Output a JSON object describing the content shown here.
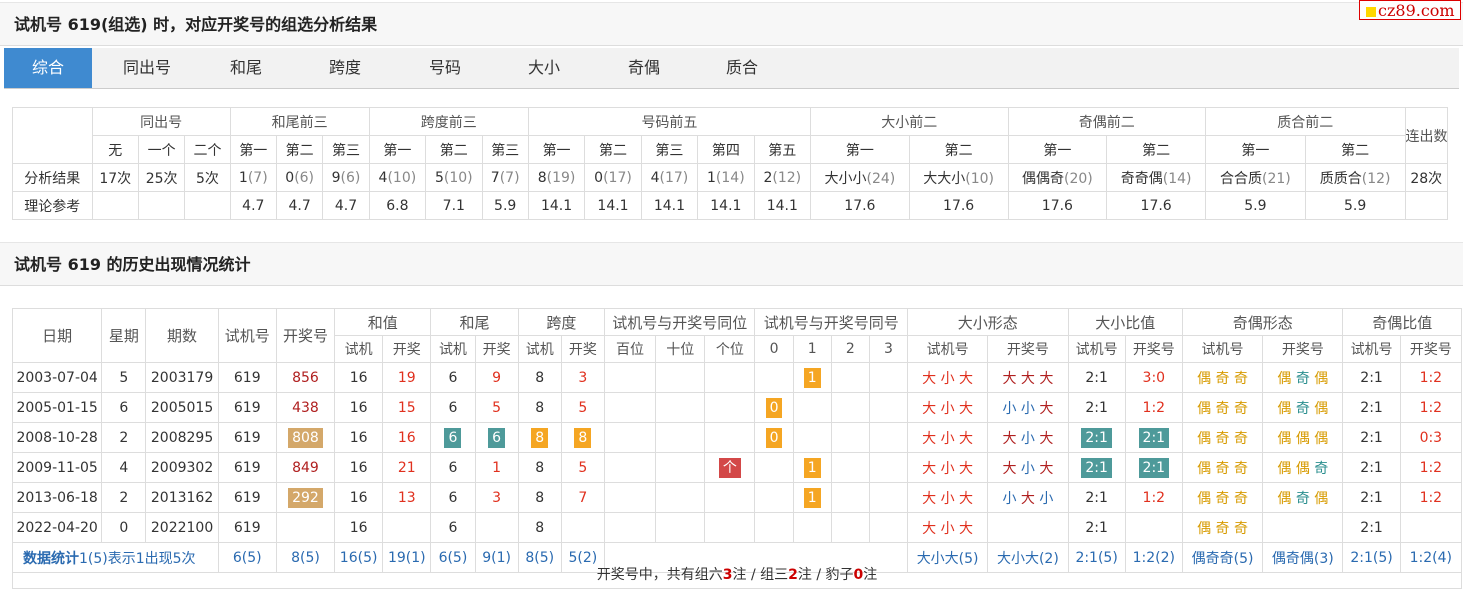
{
  "brand": "cz89.com",
  "section1_title": "试机号 619(组选) 时，对应开奖号的组选分析结果",
  "tabs": [
    "综合",
    "同出号",
    "和尾",
    "跨度",
    "号码",
    "大小",
    "奇偶",
    "质合"
  ],
  "summary": {
    "groups": [
      "同出号",
      "和尾前三",
      "跨度前三",
      "号码前五",
      "大小前二",
      "奇偶前二",
      "质合前二",
      "连出数"
    ],
    "subheads": [
      "无",
      "一个",
      "二个",
      "第一",
      "第二",
      "第三",
      "第一",
      "第二",
      "第三",
      "第一",
      "第二",
      "第三",
      "第四",
      "第五",
      "第一",
      "第二",
      "第一",
      "第二",
      "第一",
      "第二"
    ],
    "row_labels": [
      "分析结果",
      "理论参考"
    ],
    "analysis": [
      {
        "v": "17次"
      },
      {
        "v": "25次"
      },
      {
        "v": "5次"
      },
      {
        "v": "1",
        "n": "(7)"
      },
      {
        "v": "0",
        "n": "(6)"
      },
      {
        "v": "9",
        "n": "(6)"
      },
      {
        "v": "4",
        "n": "(10)"
      },
      {
        "v": "5",
        "n": "(10)"
      },
      {
        "v": "7",
        "n": "(7)"
      },
      {
        "v": "8",
        "n": "(19)"
      },
      {
        "v": "0",
        "n": "(17)"
      },
      {
        "v": "4",
        "n": "(17)"
      },
      {
        "v": "1",
        "n": "(14)"
      },
      {
        "v": "2",
        "n": "(12)"
      },
      {
        "v": "大小小",
        "n": "(24)"
      },
      {
        "v": "大大小",
        "n": "(10)"
      },
      {
        "v": "偶偶奇",
        "n": "(20)"
      },
      {
        "v": "奇奇偶",
        "n": "(14)"
      },
      {
        "v": "合合质",
        "n": "(21)"
      },
      {
        "v": "质质合",
        "n": "(12)"
      },
      {
        "v": "28次"
      }
    ],
    "theory": [
      "",
      "",
      "",
      "4.7",
      "4.7",
      "4.7",
      "6.8",
      "7.1",
      "5.9",
      "14.1",
      "14.1",
      "14.1",
      "14.1",
      "14.1",
      "17.6",
      "17.6",
      "17.6",
      "17.6",
      "5.9",
      "5.9",
      ""
    ]
  },
  "section2_title": "试机号 619 的历史出现情况统计",
  "history": {
    "head1": [
      "日期",
      "星期",
      "期数",
      "试机号",
      "开奖号",
      "和值",
      "和尾",
      "跨度",
      "试机号与开奖号同位",
      "试机号与开奖号同号",
      "大小形态",
      "大小比值",
      "奇偶形态",
      "奇偶比值"
    ],
    "head2": [
      "试机",
      "开奖",
      "试机",
      "开奖",
      "试机",
      "开奖",
      "百位",
      "十位",
      "个位",
      "0",
      "1",
      "2",
      "3",
      "试机号",
      "开奖号",
      "试机号",
      "开奖号",
      "试机号",
      "开奖号",
      "试机号",
      "开奖号"
    ],
    "rows": [
      {
        "date": "2003-07-04",
        "week": "5",
        "issue": "2003179",
        "test": "619",
        "draw": "856",
        "sum_t": "16",
        "sum_d": "19",
        "tail_t": "6",
        "tail_d": "9",
        "span_t": "8",
        "span_d": "3",
        "pos": "",
        "same": "1",
        "same_col": 1,
        "size_t": "大 小 大",
        "size_d": "大 大 大",
        "ratio_t": "2:1",
        "ratio_d": "3:0",
        "oe_t": "偶 奇 奇",
        "oe_d": "偶 奇 偶",
        "oer_t": "2:1",
        "oer_d": "1:2"
      },
      {
        "date": "2005-01-15",
        "week": "6",
        "issue": "2005015",
        "test": "619",
        "draw": "438",
        "sum_t": "16",
        "sum_d": "15",
        "tail_t": "6",
        "tail_d": "5",
        "span_t": "8",
        "span_d": "5",
        "pos": "",
        "same": "0",
        "same_col": 0,
        "size_t": "大 小 大",
        "size_d": "小 小 大",
        "ratio_t": "2:1",
        "ratio_d": "1:2",
        "oe_t": "偶 奇 奇",
        "oe_d": "偶 奇 偶",
        "oer_t": "2:1",
        "oer_d": "1:2"
      },
      {
        "date": "2008-10-28",
        "week": "2",
        "issue": "2008295",
        "test": "619",
        "draw": "808",
        "sum_t": "16",
        "sum_d": "16",
        "tail_t": "6",
        "tail_d": "6",
        "span_t": "8",
        "span_d": "8",
        "pos": "",
        "same": "0",
        "same_col": 0,
        "size_t": "大 小 大",
        "size_d": "大 小 大",
        "ratio_t": "2:1",
        "ratio_d": "2:1",
        "oe_t": "偶 奇 奇",
        "oe_d": "偶 偶 偶",
        "oer_t": "2:1",
        "oer_d": "0:3"
      },
      {
        "date": "2009-11-05",
        "week": "4",
        "issue": "2009302",
        "test": "619",
        "draw": "849",
        "sum_t": "16",
        "sum_d": "21",
        "tail_t": "6",
        "tail_d": "1",
        "span_t": "8",
        "span_d": "5",
        "pos": "个",
        "same": "1",
        "same_col": 1,
        "size_t": "大 小 大",
        "size_d": "大 小 大",
        "ratio_t": "2:1",
        "ratio_d": "2:1",
        "oe_t": "偶 奇 奇",
        "oe_d": "偶 偶 奇",
        "oer_t": "2:1",
        "oer_d": "1:2"
      },
      {
        "date": "2013-06-18",
        "week": "2",
        "issue": "2013162",
        "test": "619",
        "draw": "292",
        "sum_t": "16",
        "sum_d": "13",
        "tail_t": "6",
        "tail_d": "3",
        "span_t": "8",
        "span_d": "7",
        "pos": "",
        "same": "1",
        "same_col": 1,
        "size_t": "大 小 大",
        "size_d": "小 大 小",
        "ratio_t": "2:1",
        "ratio_d": "1:2",
        "oe_t": "偶 奇 奇",
        "oe_d": "偶 奇 偶",
        "oer_t": "2:1",
        "oer_d": "1:2"
      },
      {
        "date": "2022-04-20",
        "week": "0",
        "issue": "2022100",
        "test": "619",
        "draw": "",
        "sum_t": "16",
        "sum_d": "",
        "tail_t": "6",
        "tail_d": "",
        "span_t": "8",
        "span_d": "",
        "pos": "",
        "same": "",
        "same_col": -1,
        "size_t": "大 小 大",
        "size_d": "",
        "ratio_t": "2:1",
        "ratio_d": "",
        "oe_t": "偶 奇 奇",
        "oe_d": "",
        "oer_t": "2:1",
        "oer_d": ""
      }
    ],
    "stat": {
      "label": "数据统计",
      "note": "1(5)表示1出现5次",
      "cells": [
        "6(5)",
        "8(5)",
        "16(5)",
        "19(1)",
        "6(5)",
        "9(1)",
        "8(5)",
        "5(2)",
        "大小大(5)",
        "大小大(2)",
        "2:1(5)",
        "1:2(2)",
        "偶奇奇(5)",
        "偶奇偶(3)",
        "2:1(5)",
        "1:2(4)"
      ]
    },
    "footer": {
      "pre": "开奖号中，共有组六",
      "n1": "3",
      "mid1": "注 / 组三",
      "n2": "2",
      "mid2": "注 / 豹子",
      "n3": "0",
      "post": "注"
    }
  }
}
